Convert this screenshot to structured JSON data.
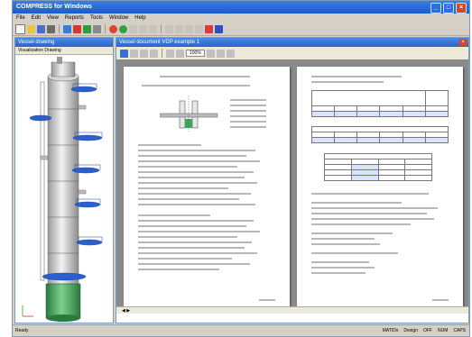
{
  "window": {
    "title": "COMPRESS for Windows"
  },
  "menu": [
    "File",
    "Edit",
    "View",
    "Reports",
    "Tools",
    "Window",
    "Help"
  ],
  "left_panel": {
    "title": "Vessel drawing",
    "tabs": "Visualization  Drawing"
  },
  "right_panel": {
    "title": "Vessel document  VDP example 1",
    "zoom": "100%"
  },
  "statusbar": {
    "left": "Ready",
    "right": [
      "MATIDs",
      "Design",
      "OFF",
      "NUM",
      "CAPS"
    ]
  },
  "colors": {
    "titlebar": "#1a5cc8",
    "vessel_green": "#3aa85a",
    "platform_blue": "#2a5fd0"
  },
  "icons": [
    "new-icon",
    "open-icon",
    "save-icon",
    "print-icon",
    "cut-icon",
    "copy-icon",
    "paste-icon",
    "undo-icon",
    "calc-icon",
    "help-icon"
  ]
}
